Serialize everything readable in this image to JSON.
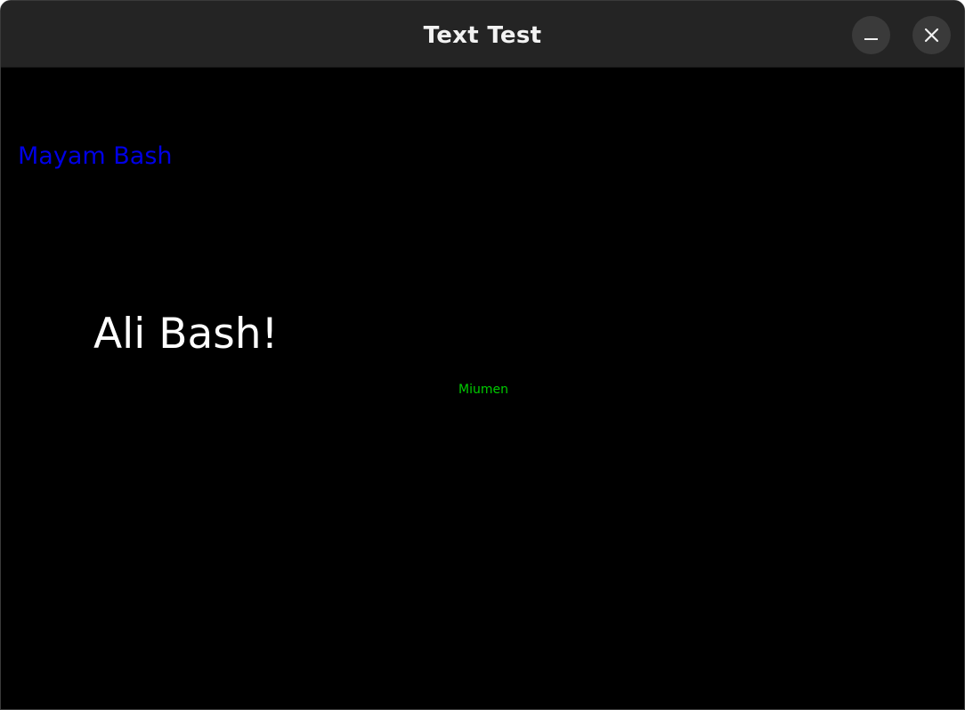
{
  "window": {
    "title": "Text Test",
    "buttons": {
      "minimize_icon": "minimize-icon",
      "close_icon": "close-icon"
    }
  },
  "canvas": {
    "background": "#000000",
    "texts": {
      "mayam": {
        "text": "Mayam Bash",
        "color": "#0000e6"
      },
      "ali": {
        "text": "Ali Bash!",
        "color": "#ffffff"
      },
      "miumen": {
        "text": "Miumen",
        "color": "#00cc00"
      }
    }
  }
}
